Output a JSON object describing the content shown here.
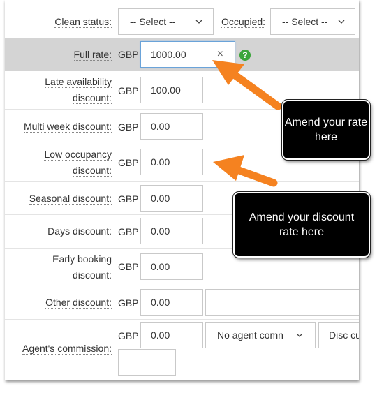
{
  "currency": "GBP",
  "clean_status": {
    "label": "Clean status:",
    "value": "-- Select --"
  },
  "occupied": {
    "label": "Occupied:",
    "value": "-- Select --"
  },
  "full_rate": {
    "label": "Full rate:",
    "value": "1000.00",
    "clear": "×",
    "help": "?"
  },
  "late_availability": {
    "label_line1": "Late availability",
    "label_line2": "discount:",
    "value": "100.00"
  },
  "multi_week": {
    "label": "Multi week discount:",
    "value": "0.00"
  },
  "low_occupancy": {
    "label_line1": "Low occupancy",
    "label_line2": "discount:",
    "value": "0.00"
  },
  "seasonal": {
    "label": "Seasonal discount:",
    "value": "0.00"
  },
  "days": {
    "label": "Days discount:",
    "value": "0.00"
  },
  "early_booking": {
    "label_line1": "Early booking",
    "label_line2": "discount:",
    "value": "0.00"
  },
  "other": {
    "label": "Other discount:",
    "value": "0.00",
    "text_value": ""
  },
  "agent": {
    "label": "Agent's commission:",
    "value": "0.00",
    "commission_select": "No agent comn",
    "disc_select": "Disc cu",
    "extra_value": ""
  },
  "callouts": {
    "rate": "Amend your rate here",
    "discount": "Amend your discount rate here"
  },
  "colors": {
    "arrow": "#f58220",
    "highlight_row": "#d4d4d4",
    "help_icon": "#3ba53b",
    "callout_bg": "#000000"
  }
}
